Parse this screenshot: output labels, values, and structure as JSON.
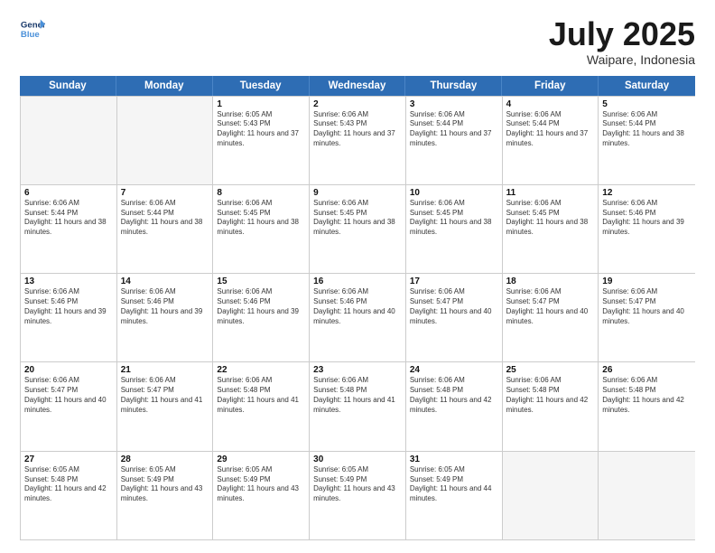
{
  "header": {
    "logo_line1": "General",
    "logo_line2": "Blue",
    "title": "July 2025",
    "subtitle": "Waipare, Indonesia"
  },
  "days_of_week": [
    "Sunday",
    "Monday",
    "Tuesday",
    "Wednesday",
    "Thursday",
    "Friday",
    "Saturday"
  ],
  "weeks": [
    [
      {
        "day": "",
        "empty": true
      },
      {
        "day": "",
        "empty": true
      },
      {
        "day": "1",
        "sunrise": "6:05 AM",
        "sunset": "5:43 PM",
        "daylight": "11 hours and 37 minutes."
      },
      {
        "day": "2",
        "sunrise": "6:06 AM",
        "sunset": "5:43 PM",
        "daylight": "11 hours and 37 minutes."
      },
      {
        "day": "3",
        "sunrise": "6:06 AM",
        "sunset": "5:44 PM",
        "daylight": "11 hours and 37 minutes."
      },
      {
        "day": "4",
        "sunrise": "6:06 AM",
        "sunset": "5:44 PM",
        "daylight": "11 hours and 37 minutes."
      },
      {
        "day": "5",
        "sunrise": "6:06 AM",
        "sunset": "5:44 PM",
        "daylight": "11 hours and 38 minutes."
      }
    ],
    [
      {
        "day": "6",
        "sunrise": "6:06 AM",
        "sunset": "5:44 PM",
        "daylight": "11 hours and 38 minutes."
      },
      {
        "day": "7",
        "sunrise": "6:06 AM",
        "sunset": "5:44 PM",
        "daylight": "11 hours and 38 minutes."
      },
      {
        "day": "8",
        "sunrise": "6:06 AM",
        "sunset": "5:45 PM",
        "daylight": "11 hours and 38 minutes."
      },
      {
        "day": "9",
        "sunrise": "6:06 AM",
        "sunset": "5:45 PM",
        "daylight": "11 hours and 38 minutes."
      },
      {
        "day": "10",
        "sunrise": "6:06 AM",
        "sunset": "5:45 PM",
        "daylight": "11 hours and 38 minutes."
      },
      {
        "day": "11",
        "sunrise": "6:06 AM",
        "sunset": "5:45 PM",
        "daylight": "11 hours and 38 minutes."
      },
      {
        "day": "12",
        "sunrise": "6:06 AM",
        "sunset": "5:46 PM",
        "daylight": "11 hours and 39 minutes."
      }
    ],
    [
      {
        "day": "13",
        "sunrise": "6:06 AM",
        "sunset": "5:46 PM",
        "daylight": "11 hours and 39 minutes."
      },
      {
        "day": "14",
        "sunrise": "6:06 AM",
        "sunset": "5:46 PM",
        "daylight": "11 hours and 39 minutes."
      },
      {
        "day": "15",
        "sunrise": "6:06 AM",
        "sunset": "5:46 PM",
        "daylight": "11 hours and 39 minutes."
      },
      {
        "day": "16",
        "sunrise": "6:06 AM",
        "sunset": "5:46 PM",
        "daylight": "11 hours and 40 minutes."
      },
      {
        "day": "17",
        "sunrise": "6:06 AM",
        "sunset": "5:47 PM",
        "daylight": "11 hours and 40 minutes."
      },
      {
        "day": "18",
        "sunrise": "6:06 AM",
        "sunset": "5:47 PM",
        "daylight": "11 hours and 40 minutes."
      },
      {
        "day": "19",
        "sunrise": "6:06 AM",
        "sunset": "5:47 PM",
        "daylight": "11 hours and 40 minutes."
      }
    ],
    [
      {
        "day": "20",
        "sunrise": "6:06 AM",
        "sunset": "5:47 PM",
        "daylight": "11 hours and 40 minutes."
      },
      {
        "day": "21",
        "sunrise": "6:06 AM",
        "sunset": "5:47 PM",
        "daylight": "11 hours and 41 minutes."
      },
      {
        "day": "22",
        "sunrise": "6:06 AM",
        "sunset": "5:48 PM",
        "daylight": "11 hours and 41 minutes."
      },
      {
        "day": "23",
        "sunrise": "6:06 AM",
        "sunset": "5:48 PM",
        "daylight": "11 hours and 41 minutes."
      },
      {
        "day": "24",
        "sunrise": "6:06 AM",
        "sunset": "5:48 PM",
        "daylight": "11 hours and 42 minutes."
      },
      {
        "day": "25",
        "sunrise": "6:06 AM",
        "sunset": "5:48 PM",
        "daylight": "11 hours and 42 minutes."
      },
      {
        "day": "26",
        "sunrise": "6:06 AM",
        "sunset": "5:48 PM",
        "daylight": "11 hours and 42 minutes."
      }
    ],
    [
      {
        "day": "27",
        "sunrise": "6:05 AM",
        "sunset": "5:48 PM",
        "daylight": "11 hours and 42 minutes."
      },
      {
        "day": "28",
        "sunrise": "6:05 AM",
        "sunset": "5:49 PM",
        "daylight": "11 hours and 43 minutes."
      },
      {
        "day": "29",
        "sunrise": "6:05 AM",
        "sunset": "5:49 PM",
        "daylight": "11 hours and 43 minutes."
      },
      {
        "day": "30",
        "sunrise": "6:05 AM",
        "sunset": "5:49 PM",
        "daylight": "11 hours and 43 minutes."
      },
      {
        "day": "31",
        "sunrise": "6:05 AM",
        "sunset": "5:49 PM",
        "daylight": "11 hours and 44 minutes."
      },
      {
        "day": "",
        "empty": true
      },
      {
        "day": "",
        "empty": true
      }
    ]
  ]
}
